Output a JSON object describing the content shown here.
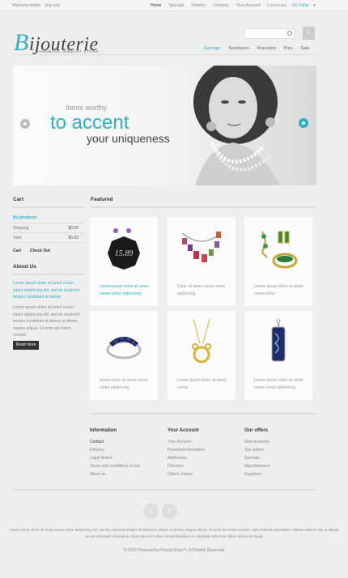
{
  "topbar": {
    "welcome": "Welcome Adam",
    "logout": "(log out)",
    "nav": [
      "Home",
      "Specials",
      "Delivery",
      "Contacts",
      "Your Account"
    ],
    "currency_label": "Currencies",
    "currency_value": "US Dollar"
  },
  "header": {
    "logo_initial": "B",
    "logo_rest": "ijouterie",
    "tagline": "HANDMADE JEWELRY STORE",
    "cart_count": "0"
  },
  "mainnav": [
    "Earrings",
    "Necklaces",
    "Bracelets",
    "Pins",
    "Sale"
  ],
  "banner": {
    "line1": "Items worthy",
    "line2": "to accent",
    "line3": "your uniqueness"
  },
  "sidebar": {
    "cart_title": "Cart",
    "no_products": "No products",
    "shipping_label": "Shipping",
    "shipping_value": "$0.00",
    "total_label": "Total",
    "total_value": "$0.00",
    "cart_link": "Cart",
    "checkout_link": "Check Out",
    "about_title": "About Us",
    "about_lead": "Lorem ipsum dolor sit amet conse ctetur adipiscing elit, sed do eiusmod tempor incididunt ut labore",
    "about_body": "Lorem ipsum dolor sit amet conse ctetur adipiscing elit, sed do eiusmod tempor incididunt ut labore et dolore magna aliqua. Ut enim ad minim veniam",
    "read_more": "Read more"
  },
  "featured": {
    "title": "Featured",
    "products": [
      {
        "text": "Lorem ipsum dolor sit amet conse ctetur adipiscing",
        "blue": true,
        "label": "15.89"
      },
      {
        "text": "Dolor sit amet conse ctetur adipiscing",
        "blue": false
      },
      {
        "text": "Lorem ipsum dolor sit amet consectetur",
        "blue": false
      },
      {
        "text": "Ipsum dolor sit amet conse ctetur adipiscing",
        "blue": false
      },
      {
        "text": "Lorem ipsum dolor sit amet conse",
        "blue": false
      },
      {
        "text": "Lorem ipsum dolor sit amet conse ctetur adipiscing",
        "blue": false
      }
    ]
  },
  "footer": {
    "columns": [
      {
        "title": "Information",
        "items": [
          "Contact",
          "Delivery",
          "Legal Notice",
          "Terms and conditions of use",
          "About us"
        ]
      },
      {
        "title": "Your Account",
        "items": [
          "Your Account",
          "Personal information",
          "Addresses",
          "Discount",
          "Orders history"
        ]
      },
      {
        "title": "Our offers",
        "items": [
          "New products",
          "Top sellers",
          "Specials",
          "Manufacturers",
          "Suppliers"
        ]
      }
    ],
    "social": [
      "t",
      "f"
    ],
    "disclaimer": "Lorem ipsum dolor sit amet conse ctetur adipiscing elit, sed do eiusmod tempor incididunt ut labore et dolore magna aliqua. Ut enim ad minim veniam, quis nostrud exercitation ullamco laboris nisi ut aliquip ex ea commodo consequat. Duis aute irure dolor in reprehenderit in voluptate velit esse cillum dolore eu fugiat",
    "copyright": "© 2012 Powered by Presta Shop™. All Rights Reserved"
  },
  "colors": {
    "accent": "#2fb0c0",
    "dark": "#333333",
    "bg": "#eeeeee"
  }
}
